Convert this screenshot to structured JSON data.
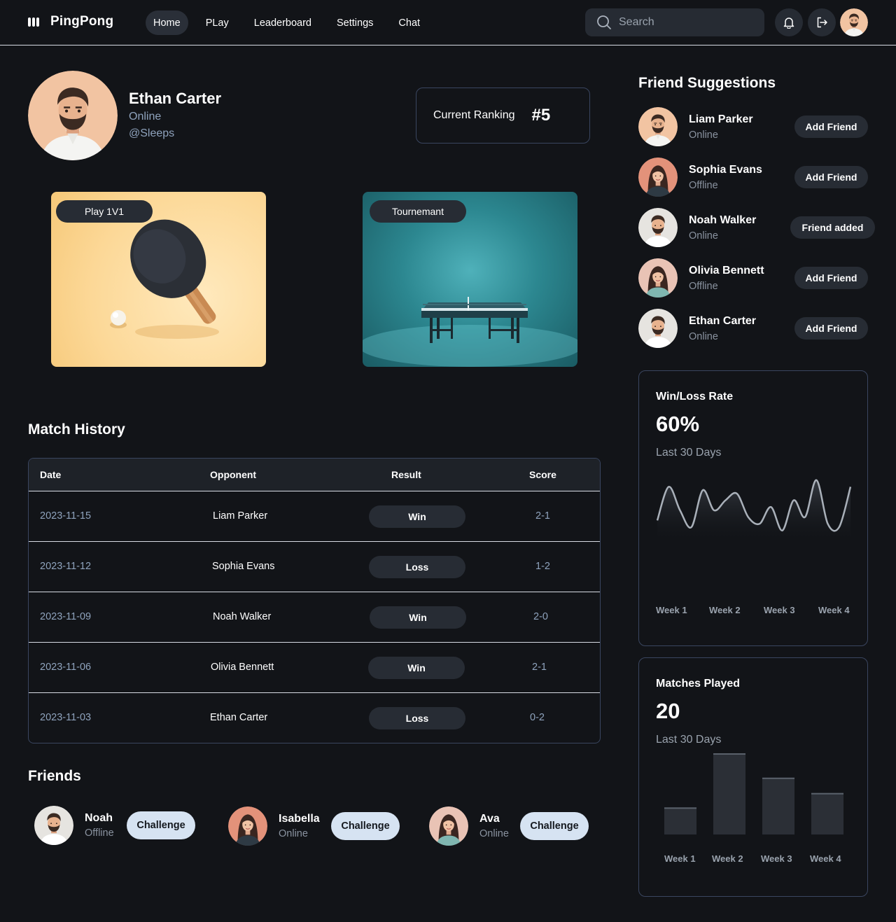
{
  "nav": {
    "logo": "PingPong",
    "links": [
      "Home",
      "PLay",
      "Leaderboard",
      "Settings",
      "Chat"
    ],
    "search_placeholder": "Search"
  },
  "profile": {
    "name": "Ethan Carter",
    "status": "Online",
    "handle": "@Sleeps",
    "ranking_label": "Current Ranking",
    "ranking_value": "#5"
  },
  "modes": {
    "play": "Play 1V1",
    "tournament": "Tournemant"
  },
  "match_history": {
    "title": "Match History",
    "columns": [
      "Date",
      "Opponent",
      "Result",
      "Score"
    ],
    "rows": [
      {
        "date": "2023-11-15",
        "opponent": "Liam Parker",
        "result": "Win",
        "score": "2-1"
      },
      {
        "date": "2023-11-12",
        "opponent": "Sophia Evans",
        "result": "Loss",
        "score": "1-2"
      },
      {
        "date": "2023-11-09",
        "opponent": "Noah Walker",
        "result": "Win",
        "score": "2-0"
      },
      {
        "date": "2023-11-06",
        "opponent": "Olivia Bennett",
        "result": "Win",
        "score": "2-1"
      },
      {
        "date": "2023-11-03",
        "opponent": "Ethan Carter",
        "result": "Loss",
        "score": "0-2"
      }
    ]
  },
  "friends": {
    "title": "Friends",
    "button_label": "Challenge",
    "items": [
      {
        "name": "Noah",
        "status": "Offline"
      },
      {
        "name": "Isabella",
        "status": "Online"
      },
      {
        "name": "Ava",
        "status": "Online"
      }
    ]
  },
  "suggestions": {
    "title": "Friend Suggestions",
    "items": [
      {
        "name": "Liam Parker",
        "status": "Online",
        "button": "Add Friend"
      },
      {
        "name": "Sophia Evans",
        "status": "Offline",
        "button": "Add Friend"
      },
      {
        "name": "Noah Walker",
        "status": "Online",
        "button": "Friend added"
      },
      {
        "name": "Olivia Bennett",
        "status": "Offline",
        "button": "Add Friend"
      },
      {
        "name": "Ethan Carter",
        "status": "Online",
        "button": "Add Friend"
      }
    ]
  },
  "winloss": {
    "label": "Win/Loss Rate",
    "value": "60%",
    "period": "Last 30 Days",
    "weeks": [
      "Week 1",
      "Week 2",
      "Week 3",
      "Week 4"
    ]
  },
  "matches_played": {
    "label": "Matches Played",
    "value": "20",
    "period": "Last 30 Days",
    "weeks": [
      "Week 1",
      "Week 2",
      "Week 3",
      "Week 4"
    ]
  },
  "chart_data": [
    {
      "type": "line",
      "title": "Win/Loss Rate",
      "categories": [
        "Week 1",
        "Week 2",
        "Week 3",
        "Week 4"
      ],
      "values": [
        0.35,
        0.85,
        0.5,
        0.25,
        0.8,
        0.5,
        0.65,
        0.75,
        0.4,
        0.3,
        0.55,
        0.2,
        0.65,
        0.4,
        0.95,
        0.3,
        0.25,
        0.85
      ],
      "ylim": [
        0,
        1
      ],
      "grid": false
    },
    {
      "type": "bar",
      "title": "Matches Played",
      "categories": [
        "Week 1",
        "Week 2",
        "Week 3",
        "Week 4"
      ],
      "values": [
        3,
        9,
        6.3,
        4.6
      ],
      "ylim": [
        0,
        9
      ],
      "grid": false
    }
  ],
  "colors": {
    "background": "#121418",
    "accent_text": "#8fa3bd",
    "pill": "#272c34",
    "challenge_button": "#d6e3f2"
  }
}
